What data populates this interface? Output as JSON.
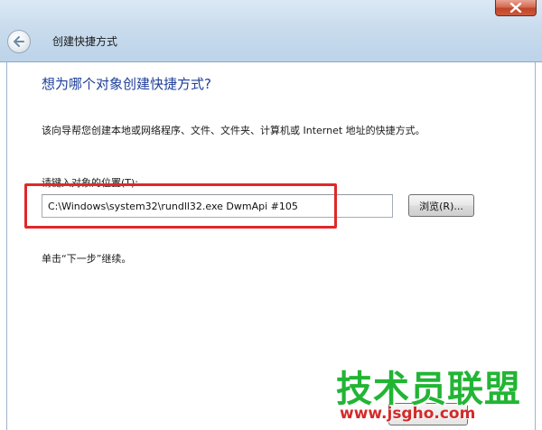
{
  "window": {
    "title": "创建快捷方式"
  },
  "wizard": {
    "heading": "想为哪个对象创建快捷方式?",
    "description": "该向导帮您创建本地或网络程序、文件、文件夹、计算机或 Internet 地址的快捷方式。",
    "location_label": "请键入对象的位置(T):",
    "location_value": "C:\\Windows\\system32\\rundll32.exe DwmApi #105",
    "browse_label": "浏览(R)...",
    "continue_hint": "单击“下一步”继续。"
  },
  "watermark": {
    "title": "技术员联盟",
    "url": "www.jsgho.com"
  },
  "colors": {
    "heading": "#1e3f9a",
    "highlight_border": "#e02828",
    "watermark_green": "#22b534",
    "watermark_red": "#d42a2a",
    "close_button": "#c14527"
  },
  "icons": {
    "close": "close-icon",
    "back": "back-arrow-icon"
  }
}
